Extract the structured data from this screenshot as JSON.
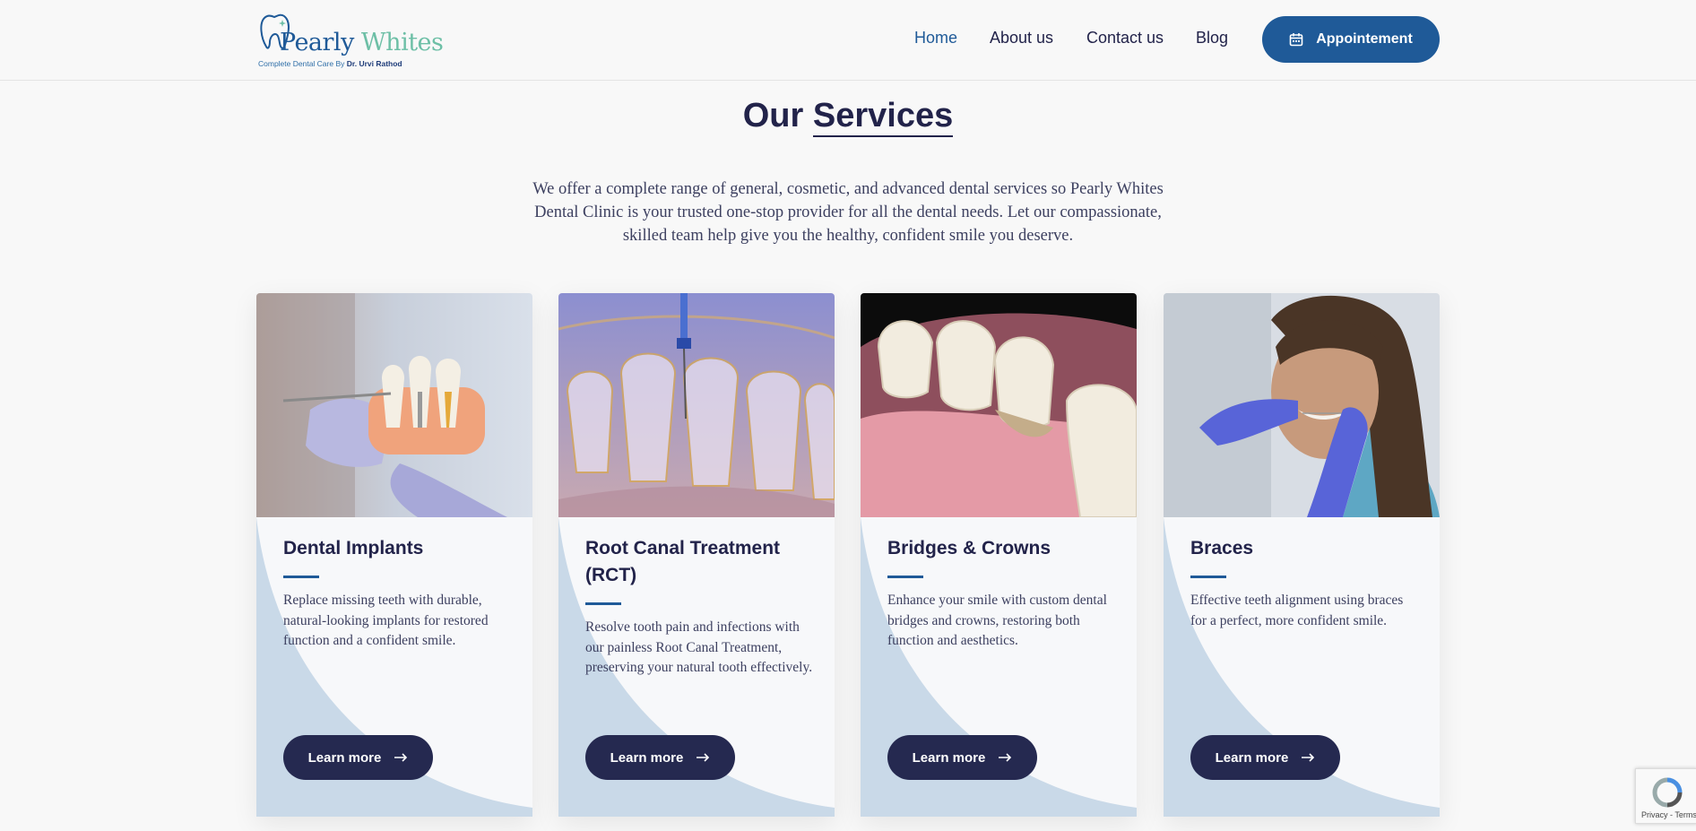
{
  "brand": {
    "name_part1": "Pearly ",
    "name_part2": "Whites",
    "tagline": "Complete Dental Care By ",
    "tagline_doctor": "Dr. Urvi Rathod"
  },
  "nav": {
    "items": [
      {
        "label": "Home",
        "active": true
      },
      {
        "label": "About us",
        "active": false
      },
      {
        "label": "Contact us",
        "active": false
      },
      {
        "label": "Blog",
        "active": false
      }
    ],
    "cta_label": "Appointement",
    "cta_icon": "calendar-icon"
  },
  "services": {
    "title_part1": "Our ",
    "title_part2": "Services",
    "intro": "We offer a complete range of general, cosmetic, and advanced dental services so Pearly Whites Dental Clinic is your trusted one-stop provider for all the dental needs. Let our compassionate, skilled team help give you the healthy, confident smile you deserve.",
    "cards": [
      {
        "title": "Dental Implants",
        "description": "Replace missing teeth with durable, natural-looking implants for restored function and a confident smile.",
        "button": "Learn more",
        "image": "dental-implant-model-photo"
      },
      {
        "title": "Root Canal Treatment (RCT)",
        "description": "Resolve tooth pain and infections with our painless Root Canal Treatment, preserving your natural tooth effectively.",
        "button": "Learn more",
        "image": "root-canal-illustration"
      },
      {
        "title": "Bridges & Crowns",
        "description": "Enhance your smile with custom dental bridges and crowns, restoring both function and aesthetics.",
        "button": "Learn more",
        "image": "dental-bridge-render"
      },
      {
        "title": "Braces",
        "description": "Effective teeth alignment using braces for a perfect, more confident smile.",
        "button": "Learn more",
        "image": "braces-patient-photo"
      }
    ]
  },
  "recaptcha": {
    "label": "Privacy - Terms"
  },
  "colors": {
    "primary": "#1f5a98",
    "dark_navy": "#252950",
    "accent_green": "#6dbfa6",
    "card_wave": "#c9d9e8"
  }
}
